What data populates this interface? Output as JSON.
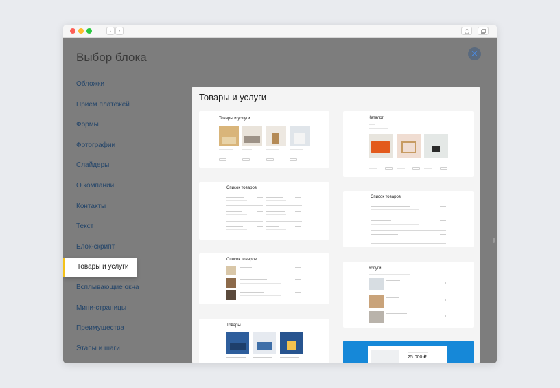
{
  "modal": {
    "title": "Выбор блока",
    "close_label": "×"
  },
  "menu": {
    "items": [
      "Обложки",
      "Прием платежей",
      "Формы",
      "Фотографии",
      "Слайдеры",
      "О компании",
      "Контакты",
      "Текст",
      "Блок-скрипт",
      "Товары и услуги",
      "Всплывающие окна",
      "Мини-страницы",
      "Преимущества",
      "Этапы и шаги"
    ],
    "active": "Товары и услуги"
  },
  "panel": {
    "title": "Товары и услуги",
    "cards": {
      "c1": {
        "title": "Товары и услуги"
      },
      "c2": {
        "title": "Каталог"
      },
      "c3": {
        "title": "Список товаров"
      },
      "c4": {
        "title": "Список товаров"
      },
      "c5": {
        "title": "Список товаров"
      },
      "c6": {
        "title": "Услуги"
      },
      "c7": {
        "title": "Товары"
      },
      "c8": {
        "price": "25 000 ₽"
      }
    }
  },
  "colors": {
    "accent": "#f4c21a",
    "link": "#25466a",
    "close_icon": "#4b8ce4",
    "promo_blue": "#1688d8"
  }
}
